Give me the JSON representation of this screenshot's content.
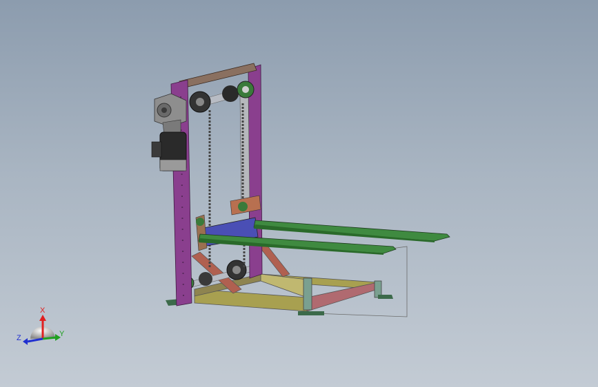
{
  "viewport": {
    "background_top": "#8c9cae",
    "background_bottom": "#c3cbd4"
  },
  "model": {
    "frame_color": "#8a3f8e",
    "top_beam_color": "#8a7060",
    "shaft_color": "#b8bcc4",
    "fork_color": "#3f8a40",
    "carriage_color": "#4a4fb5",
    "base_color": "#a8a050",
    "strut_color": "#b06050",
    "motor_color": "#2a2a2a",
    "gearbox_color": "#8e8e8e",
    "bearing_color": "#3a7a3a",
    "chain_color": "#444444"
  },
  "triad": {
    "x_label": "X",
    "y_label": "Y",
    "z_label": "Z",
    "x_color": "#e02020",
    "y_color": "#20a020",
    "z_color": "#2030d0"
  }
}
